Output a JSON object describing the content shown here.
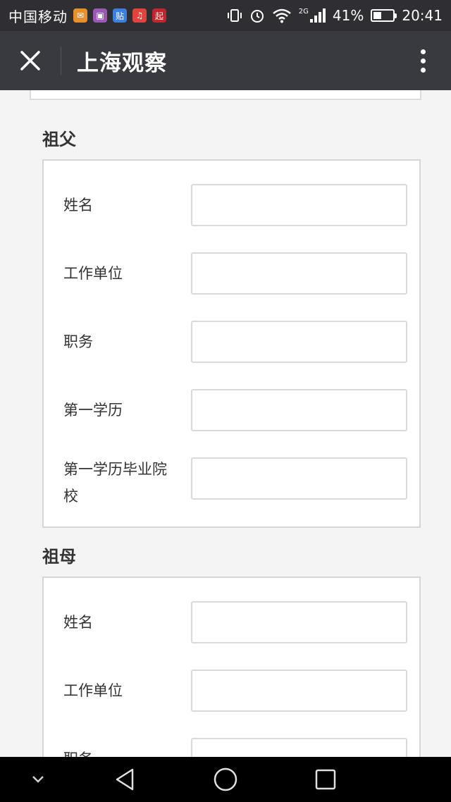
{
  "status_bar": {
    "carrier": "中国移动",
    "app_icons": [
      {
        "name": "orange-app-icon",
        "color": "#e8912a",
        "glyph": "✉"
      },
      {
        "name": "purple-app-icon",
        "color": "#9b59b6",
        "glyph": "▣"
      },
      {
        "name": "tieba-app-icon",
        "color": "#3c7fe0",
        "glyph": "贴"
      },
      {
        "name": "music-app-icon",
        "color": "#e0443a",
        "glyph": "♫"
      },
      {
        "name": "qidian-app-icon",
        "color": "#c0262d",
        "glyph": "起"
      }
    ],
    "network": "2G",
    "battery_level": 0.41,
    "battery_text": "41%",
    "time": "20:41"
  },
  "title_bar": {
    "title": "上海观察"
  },
  "sections": [
    {
      "title": "祖父",
      "fields": [
        {
          "label": "姓名",
          "value": "",
          "placeholder": ""
        },
        {
          "label": "工作单位",
          "value": "",
          "placeholder": ""
        },
        {
          "label": "职务",
          "value": "",
          "placeholder": ""
        },
        {
          "label": "第一学历",
          "value": "",
          "placeholder": ""
        },
        {
          "label": "第一学历毕业院校",
          "value": "",
          "placeholder": ""
        }
      ]
    },
    {
      "title": "祖母",
      "fields": [
        {
          "label": "姓名",
          "value": "",
          "placeholder": ""
        },
        {
          "label": "工作单位",
          "value": "",
          "placeholder": ""
        },
        {
          "label": "职务",
          "value": "",
          "placeholder": ""
        }
      ]
    }
  ],
  "colors": {
    "status_bar_bg": "#2f2f33",
    "title_bar_bg": "#393a3f",
    "page_bg": "#f4f4f4",
    "card_border": "#d6d6d6"
  }
}
